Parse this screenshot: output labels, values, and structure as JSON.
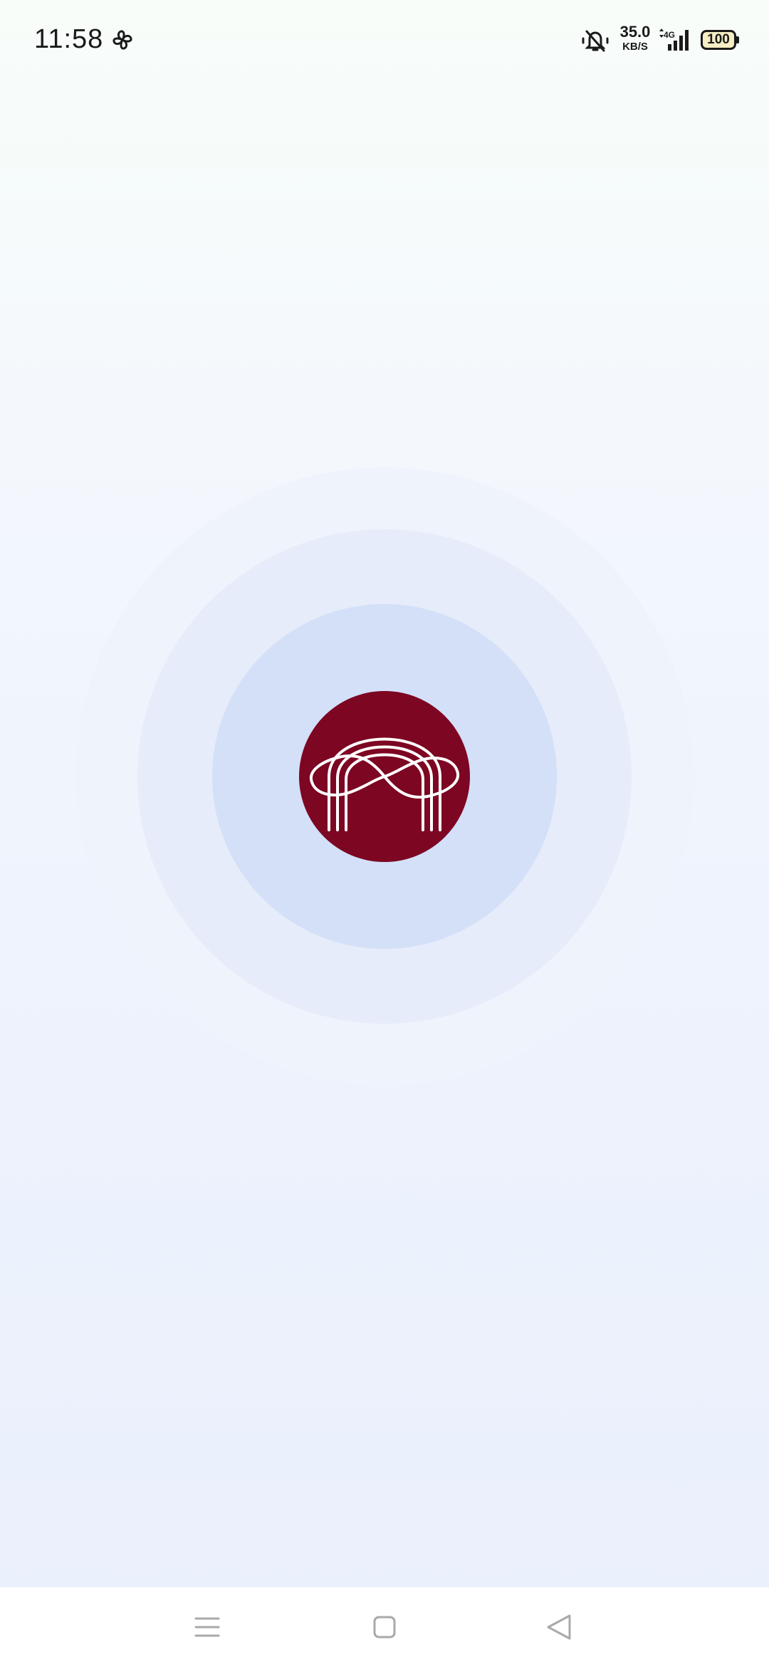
{
  "status_bar": {
    "time": "11:58",
    "net_speed_value": "35.0",
    "net_speed_unit": "KB/S",
    "network_type": "4G",
    "battery_level": "100",
    "icons": [
      "fan-icon",
      "mute-icon",
      "signal-icon",
      "battery-icon"
    ]
  },
  "splash": {
    "logo": "infinity-arch-logo",
    "logo_color": "#7d0622",
    "ring_colors": [
      "#eef3fc",
      "#e6ecf9",
      "#d3e0f8"
    ]
  },
  "nav_bar": {
    "buttons": [
      "menu-icon",
      "home-icon",
      "back-icon"
    ]
  }
}
